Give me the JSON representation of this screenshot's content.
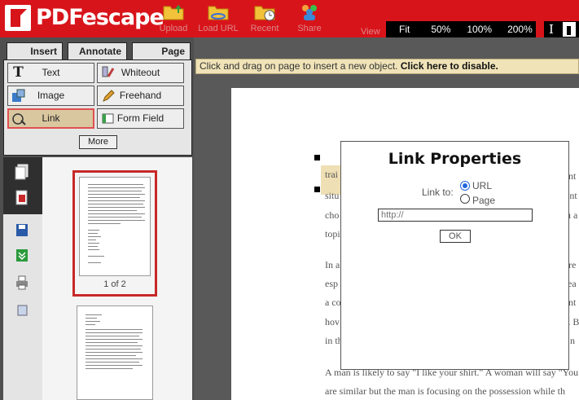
{
  "app": {
    "logo_text": "PDFescape",
    "toolbar": [
      {
        "label": "Upload",
        "icon": "folder-upload-icon"
      },
      {
        "label": "Load URL",
        "icon": "folder-link-icon"
      },
      {
        "label": "Recent",
        "icon": "folder-clock-icon"
      },
      {
        "label": "Share",
        "icon": "users-icon"
      }
    ],
    "view_label": "View",
    "zoom": [
      "Fit",
      "50%",
      "100%",
      "200%"
    ],
    "cursor_tools": {
      "text_tool": "I"
    }
  },
  "left_panel": {
    "tabs": [
      "Insert",
      "Annotate",
      "Page"
    ],
    "insert_tools": [
      {
        "label": "Text",
        "icon_glyph": "T"
      },
      {
        "label": "Whiteout"
      },
      {
        "label": "Image"
      },
      {
        "label": "Freehand"
      },
      {
        "label": "Link"
      },
      {
        "label": "Form Field"
      }
    ],
    "more_label": "More",
    "thumbnails": [
      {
        "label": "1 of 2"
      }
    ]
  },
  "main": {
    "info_bar": {
      "text": "Click and drag on page to insert a new object.",
      "action": "Click here to disable."
    },
    "document_lines": [
      "trai",
      "situ",
      "cho",
      "topi",
      "In a",
      "esp",
      "a co",
      "hov",
      "in th",
      "A man is likely to say \"I like your shirt.\" A woman will say \"You",
      "are similar but the man is focusing on the possession while th"
    ],
    "document_right_fragments": [
      "nt",
      "ent",
      "u a",
      "re",
      "ea",
      "nt",
      "e. B",
      "n"
    ]
  },
  "modal": {
    "title": "Link Properties",
    "link_to_label": "Link to:",
    "options": [
      "URL",
      "Page"
    ],
    "selected": "URL",
    "url_placeholder": "http://",
    "ok_label": "OK"
  },
  "colors": {
    "brand_red": "#d8141b",
    "panel_dark": "#4f4f4f",
    "link_highlight": "#d9c7a0",
    "info_bar": "#f0e3b8"
  }
}
